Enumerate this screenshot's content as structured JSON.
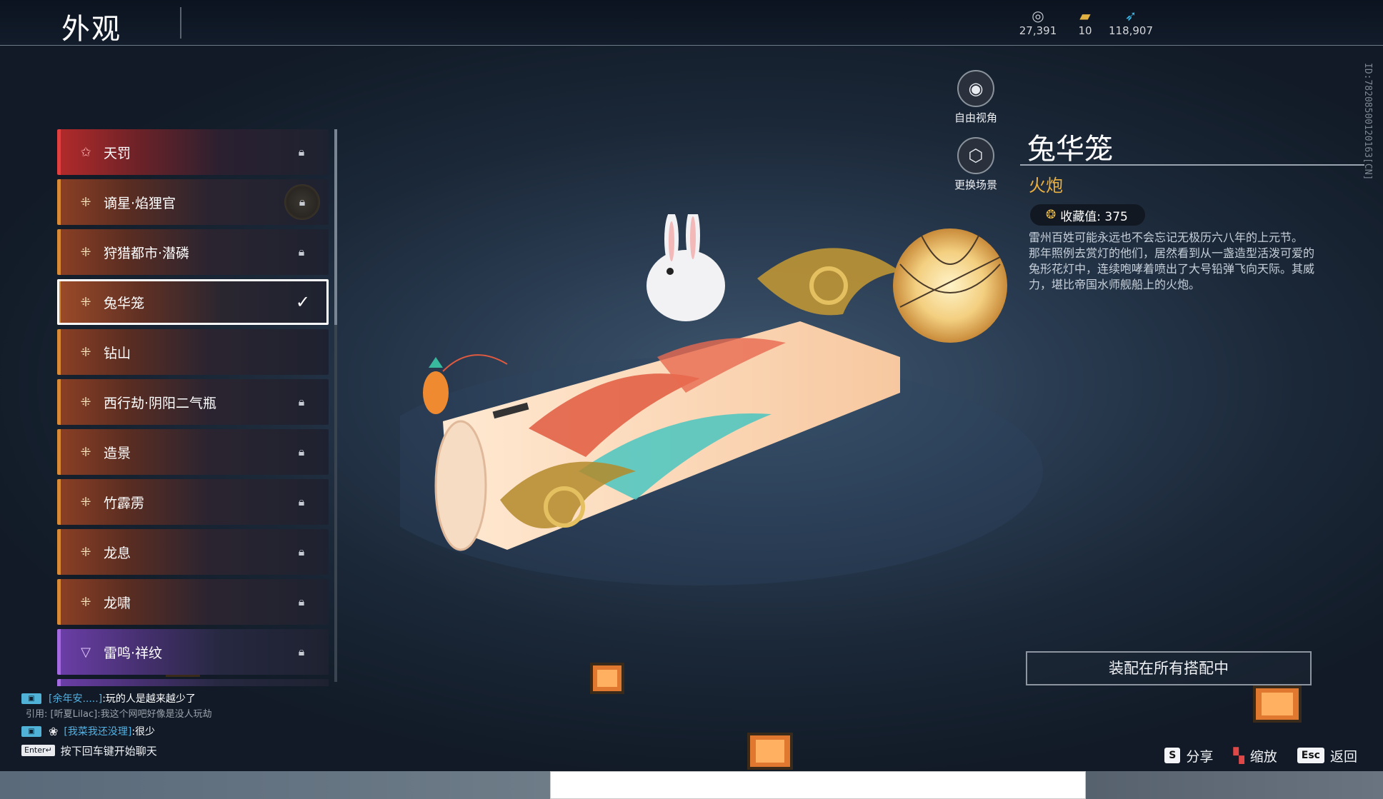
{
  "header": {
    "title": "外观",
    "currencies": [
      {
        "icon": "silver-coin-icon",
        "value": "27,391"
      },
      {
        "icon": "ticket-icon",
        "value": "10"
      },
      {
        "icon": "feather-icon",
        "value": "118,907"
      }
    ]
  },
  "skins": [
    {
      "name": "天罚",
      "rarity": "red",
      "status": "locked"
    },
    {
      "name": "谪星·焰狸官",
      "rarity": "orange",
      "status": "locked-badge"
    },
    {
      "name": "狩猎都市·潜磷",
      "rarity": "orange",
      "status": "locked"
    },
    {
      "name": "兔华笼",
      "rarity": "orange",
      "status": "selected"
    },
    {
      "name": "钻山",
      "rarity": "orange",
      "status": "owned"
    },
    {
      "name": "西行劫·阴阳二气瓶",
      "rarity": "orange",
      "status": "locked"
    },
    {
      "name": "造景",
      "rarity": "orange",
      "status": "locked"
    },
    {
      "name": "竹霹雳",
      "rarity": "orange",
      "status": "locked"
    },
    {
      "name": "龙息",
      "rarity": "orange",
      "status": "locked"
    },
    {
      "name": "龙啸",
      "rarity": "orange",
      "status": "locked"
    },
    {
      "name": "雷鸣·祥纹",
      "rarity": "purple",
      "status": "locked"
    }
  ],
  "view_buttons": {
    "free_camera": "自由视角",
    "change_scene": "更换场景"
  },
  "item": {
    "name": "兔华笼",
    "type": "火炮",
    "collect_label": "收藏值: 375",
    "desc_1": "雷州百姓可能永远也不会忘记无极历六八年的上元节。",
    "desc_2": "那年照例去赏灯的他们，居然看到从一盏造型活泼可爱的兔形花灯中，连续咆哮着喷出了大号铅弹飞向天际。其威力，堪比帝国水师舰船上的火炮。",
    "side_id": "ID:78208500120163[CN]",
    "equip_button": "装配在所有搭配中"
  },
  "chat": {
    "line1_user": "[余年安.....]",
    "line1_text": ":玩的人是越来越少了",
    "line1_quote": "引用: [听夏Lilac]:我这个网吧好像是没人玩劫",
    "line2_user": "[我菜我还没理]",
    "line2_text": ":很少",
    "enter_key": "Enter↵",
    "hint": "按下回车键开始聊天"
  },
  "bottom_keys": [
    {
      "key": "S",
      "label": "分享"
    },
    {
      "key": "",
      "label": "缩放"
    },
    {
      "key": "Esc",
      "label": "返回"
    }
  ],
  "colors": {
    "accent_gold": "#e9b040",
    "chat_user": "#4fb2e6",
    "rarity_orange": "#d88a36",
    "rarity_red": "#e04040",
    "rarity_purple": "#a46be0"
  }
}
